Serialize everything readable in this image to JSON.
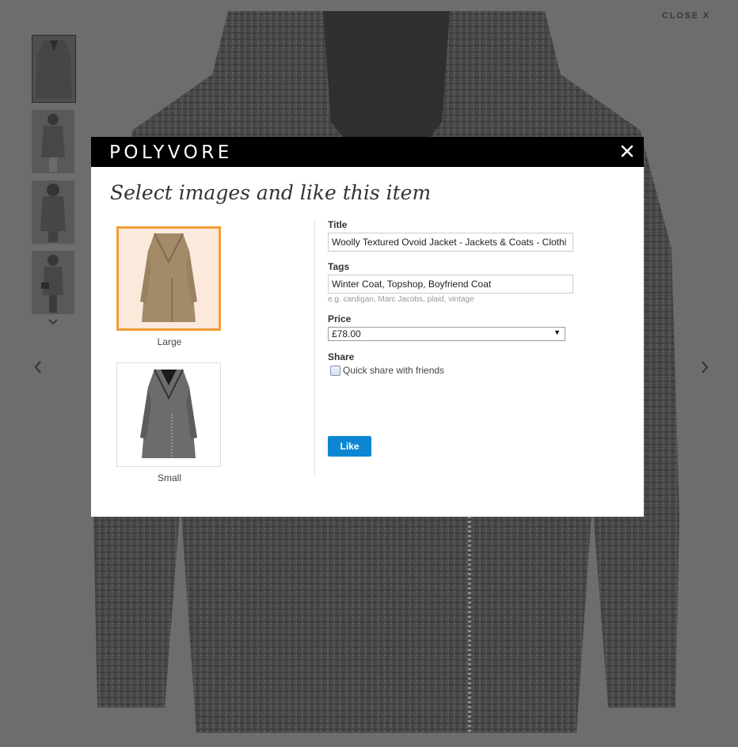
{
  "viewer": {
    "close_label": "CLOSE X",
    "thumbnails": [
      "coat-front",
      "model-front",
      "model-back",
      "model-side"
    ],
    "more_icon": "chevron-down-icon",
    "prev_icon": "chevron-left-icon",
    "next_icon": "chevron-right-icon"
  },
  "modal": {
    "brand": "POLYVORE",
    "close_icon": "close-icon",
    "heading": "Select images and like this item",
    "images": [
      {
        "caption": "Large",
        "selected": true
      },
      {
        "caption": "Small",
        "selected": false
      }
    ],
    "form": {
      "title_label": "Title",
      "title_value": "Woolly Textured Ovoid Jacket - Jackets & Coats - Clothi",
      "tags_label": "Tags",
      "tags_value": "Winter Coat, Topshop, Boyfriend Coat",
      "tags_hint": "e.g. cardigan, Marc Jacobs, plaid, vintage",
      "price_label": "Price",
      "price_value": "£78.00",
      "share_label": "Share",
      "share_option": "Quick share with friends",
      "share_checked": false,
      "like_label": "Like"
    }
  },
  "colors": {
    "accent": "#0b86d3",
    "selected_border": "#f39c33",
    "header_bg": "#000000"
  }
}
